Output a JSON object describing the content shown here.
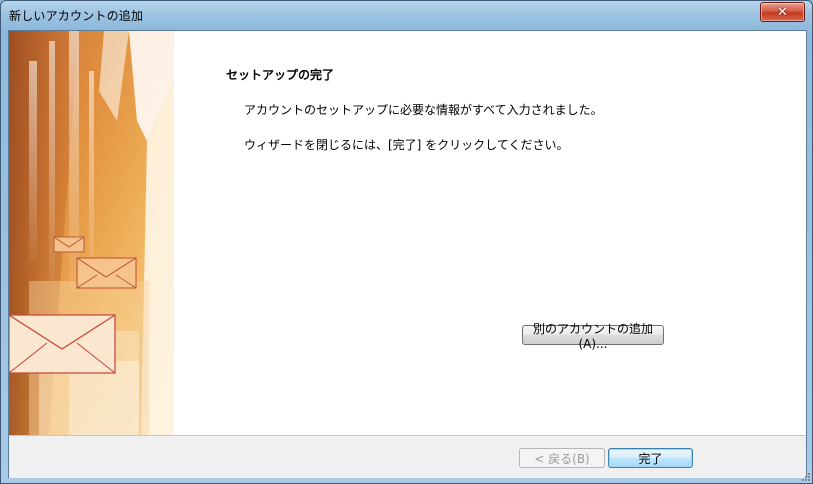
{
  "window": {
    "title": "新しいアカウントの追加"
  },
  "icons": {
    "close": "close-icon",
    "envelope": "envelope-icon"
  },
  "colors": {
    "accent_blue": "#3c7fb1",
    "titlebar": "#9ec4e2",
    "close_red": "#c23a22",
    "art_orange": "#d9822b"
  },
  "content": {
    "heading": "セットアップの完了",
    "message_1": "アカウントのセットアップに必要な情報がすべて入力されました。",
    "message_2": "ウィザードを閉じるには、[完了] をクリックしてください。"
  },
  "buttons": {
    "add_another_account": "別のアカウントの追加(A)...",
    "back": "< 戻る(B)",
    "finish": "完了"
  }
}
